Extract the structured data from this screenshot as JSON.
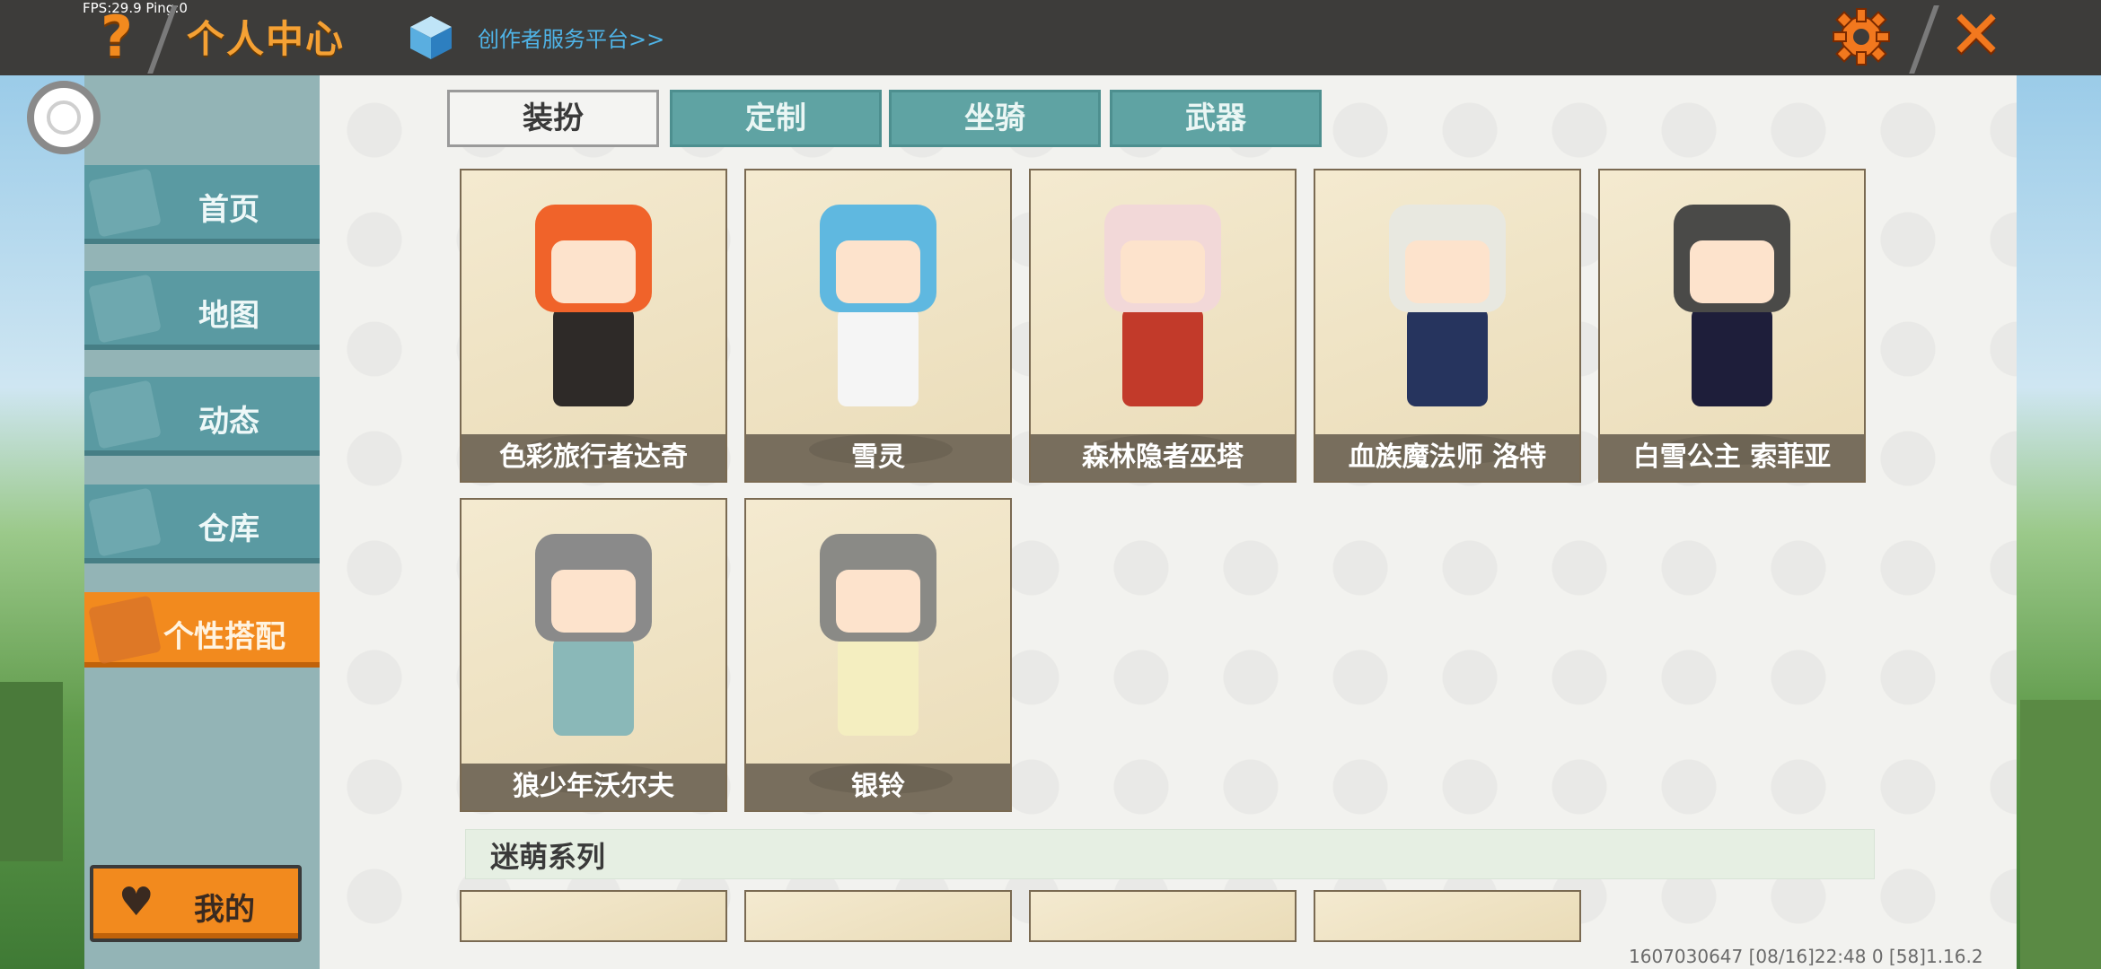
{
  "hud": {
    "fps_text": "FPS:29.9  Ping:0"
  },
  "header": {
    "title": "个人中心",
    "creator_link": "创作者服务平台>>",
    "help_icon": "question-icon",
    "help_glyph": "?",
    "settings_icon": "gear-icon",
    "close_icon": "close-icon",
    "close_glyph": "✕"
  },
  "sidebar": {
    "items": [
      {
        "label": "首页",
        "icon": "home-icon"
      },
      {
        "label": "地图",
        "icon": "map-icon"
      },
      {
        "label": "动态",
        "icon": "bell-icon"
      },
      {
        "label": "仓库",
        "icon": "house-icon"
      },
      {
        "label": "个性搭配",
        "icon": "outfit-icon",
        "active": true
      }
    ],
    "my_button": {
      "label": "我的",
      "icon": "heart-icon",
      "glyph": "♥"
    }
  },
  "tabs": [
    {
      "label": "装扮",
      "active": true
    },
    {
      "label": "定制"
    },
    {
      "label": "坐骑"
    },
    {
      "label": "武器"
    }
  ],
  "skins": [
    {
      "name": "色彩旅行者达奇",
      "hair": "#f0632a",
      "outfit": "#2e2a28"
    },
    {
      "name": "雪灵",
      "hair": "#5fb8e0",
      "outfit": "#f5f5f5"
    },
    {
      "name": "森林隐者巫塔",
      "hair": "#f2d8d8",
      "outfit": "#c23a2a"
    },
    {
      "name": "血族魔法师 洛特",
      "hair": "#e8e8e0",
      "outfit": "#26345e"
    },
    {
      "name": "白雪公主 索菲亚",
      "hair": "#4a4a48",
      "outfit": "#1e1e3a"
    },
    {
      "name": "狼少年沃尔夫",
      "hair": "#8a8a8a",
      "outfit": "#8ab8b8"
    },
    {
      "name": "银铃",
      "hair": "#8a8a86",
      "outfit": "#f4eec0"
    }
  ],
  "series": {
    "title": "迷萌系列"
  },
  "footer": {
    "text": "1607030647   [08/16]22:48 0   [58]1.16.2"
  }
}
